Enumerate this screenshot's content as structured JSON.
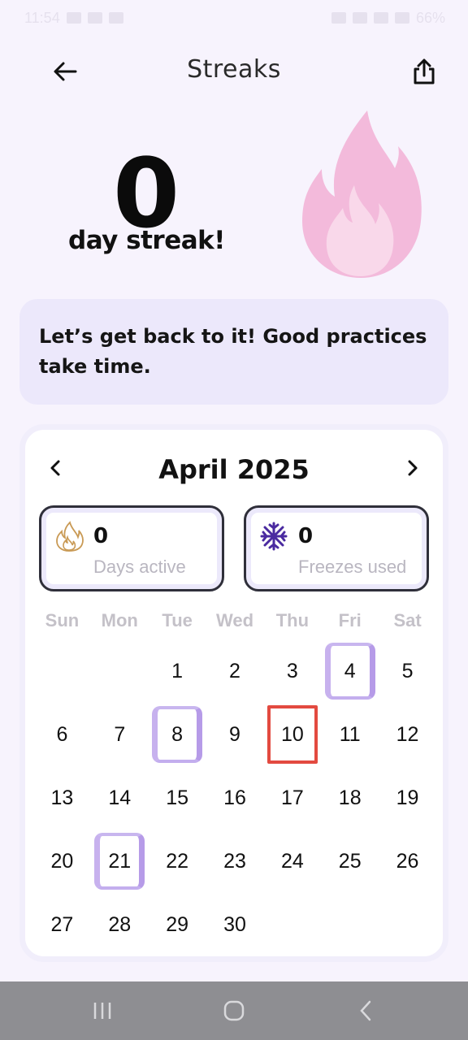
{
  "status_bar": {
    "time": "11:54",
    "battery": "66%"
  },
  "header": {
    "title": "Streaks"
  },
  "streak": {
    "count": "0",
    "label": "day streak!"
  },
  "message": {
    "text": "Let’s get back to it! Good practices take time."
  },
  "calendar": {
    "month_title": "April 2025",
    "stats": {
      "days_active": {
        "value": "0",
        "label": "Days active"
      },
      "freezes_used": {
        "value": "0",
        "label": "Freezes used"
      }
    },
    "weekdays": [
      "Sun",
      "Mon",
      "Tue",
      "Wed",
      "Thu",
      "Fri",
      "Sat"
    ],
    "days": [
      "",
      "",
      "1",
      "2",
      "3",
      "4",
      "5",
      "6",
      "7",
      "8",
      "9",
      "10",
      "11",
      "12",
      "13",
      "14",
      "15",
      "16",
      "17",
      "18",
      "19",
      "20",
      "21",
      "22",
      "23",
      "24",
      "25",
      "26",
      "27",
      "28",
      "29",
      "30"
    ],
    "highlighted_days": [
      "4",
      "8",
      "21"
    ],
    "today": "10"
  },
  "colors": {
    "accent_purple": "#b69be8",
    "flame_pink": "#f2b8da",
    "today_outline": "#e34a40"
  }
}
